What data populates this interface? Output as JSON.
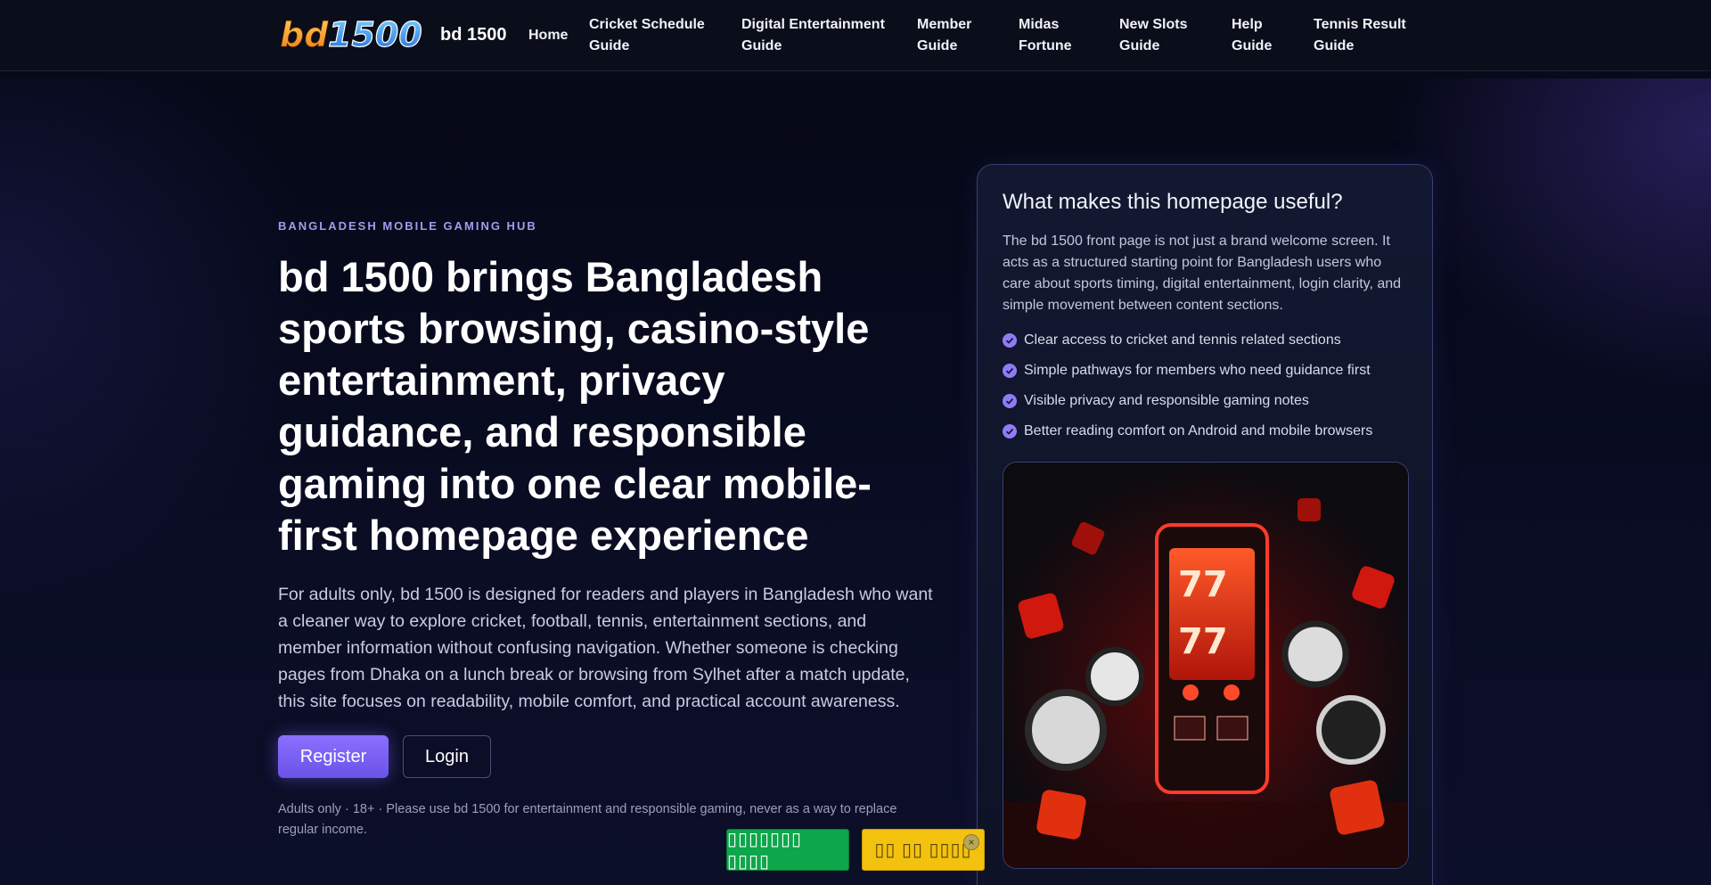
{
  "header": {
    "logo_text": "bd1500",
    "brand": "bd 1500",
    "nav": [
      {
        "line1": "Home",
        "line2": ""
      },
      {
        "line1": "Cricket Schedule",
        "line2": "Guide"
      },
      {
        "line1": "Digital Entertainment",
        "line2": "Guide"
      },
      {
        "line1": "Member",
        "line2": "Guide"
      },
      {
        "line1": "Midas",
        "line2": "Fortune"
      },
      {
        "line1": "New Slots",
        "line2": "Guide"
      },
      {
        "line1": "Help",
        "line2": "Guide"
      },
      {
        "line1": "Tennis Result",
        "line2": "Guide"
      }
    ]
  },
  "hero": {
    "eyebrow": "BANGLADESH MOBILE GAMING HUB",
    "headline": "bd 1500 brings Bangladesh sports browsing, casino-style entertainment, privacy guidance, and responsible gaming into one clear mobile-first homepage experience",
    "lead": "For adults only, bd 1500 is designed for readers and players in Bangladesh who want a cleaner way to explore cricket, football, tennis, entertainment sections, and member information without confusing navigation. Whether someone is checking pages from Dhaka on a lunch break or browsing from Sylhet after a match update, this site focuses on readability, mobile comfort, and practical account awareness.",
    "register_label": "Register",
    "login_label": "Login",
    "disclaimer": "Adults only · 18+ · Please use bd 1500 for entertainment and responsible gaming, never as a way to replace regular income."
  },
  "card": {
    "title": "What makes this homepage useful?",
    "description": "The bd 1500 front page is not just a brand welcome screen. It acts as a structured starting point for Bangladesh users who care about sports timing, digital entertainment, login clarity, and simple movement between content sections.",
    "features": [
      "Clear access to cricket and tennis related sections",
      "Simple pathways for members who need guidance first",
      "Visible privacy and responsible gaming notes",
      "Better reading comfort on Android and mobile browsers"
    ],
    "image_icon": "slot-machine-casino-image"
  },
  "floating": {
    "green_label": "▯▯▯▯▯▯▯ ▯▯▯▯",
    "yellow_label": "▯▯ ▯▯ ▯▯▯▯",
    "close_label": "×"
  },
  "colors": {
    "accent": "#7a62ff",
    "check": "#8f7cf5",
    "float_green": "#0ea64a",
    "float_yellow": "#f3c20f"
  }
}
